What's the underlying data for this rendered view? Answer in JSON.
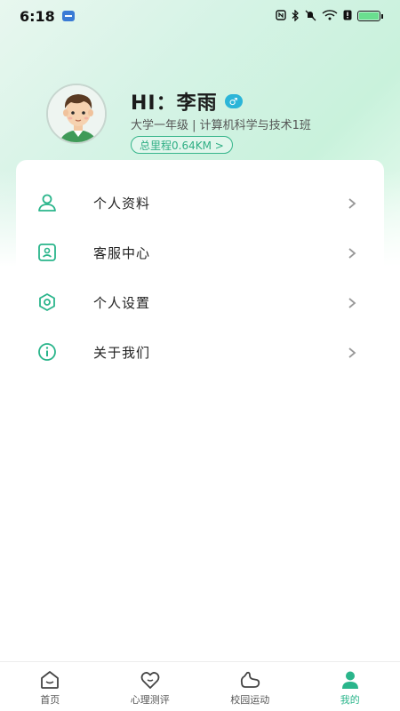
{
  "status_bar": {
    "time": "6:18",
    "icons": [
      "app-notification-icon",
      "nfc-icon",
      "bluetooth-icon",
      "mute-icon",
      "wifi-icon",
      "alert-icon",
      "battery-charging-icon"
    ]
  },
  "profile": {
    "greeting": "HI：李雨",
    "gender_symbol": "♂",
    "class_info": "大学一年级 | 计算机科学与技术1班",
    "mileage": "总里程0.64KM >"
  },
  "menu": {
    "items": [
      {
        "label": "个人资料",
        "icon": "person-icon"
      },
      {
        "label": "客服中心",
        "icon": "customer-service-icon"
      },
      {
        "label": "个人设置",
        "icon": "settings-hexagon-icon"
      },
      {
        "label": "关于我们",
        "icon": "info-icon"
      }
    ],
    "arrow": "›"
  },
  "bottom_nav": {
    "items": [
      {
        "label": "首页",
        "icon": "home-icon",
        "active": false
      },
      {
        "label": "心理测评",
        "icon": "heart-icon",
        "active": false
      },
      {
        "label": "校园运动",
        "icon": "sport-icon",
        "active": false
      },
      {
        "label": "我的",
        "icon": "profile-icon",
        "active": true
      }
    ]
  },
  "colors": {
    "accent": "#2ab58b",
    "gradient_top": "#c9f2dc",
    "gender_badge": "#2bb5d8"
  }
}
